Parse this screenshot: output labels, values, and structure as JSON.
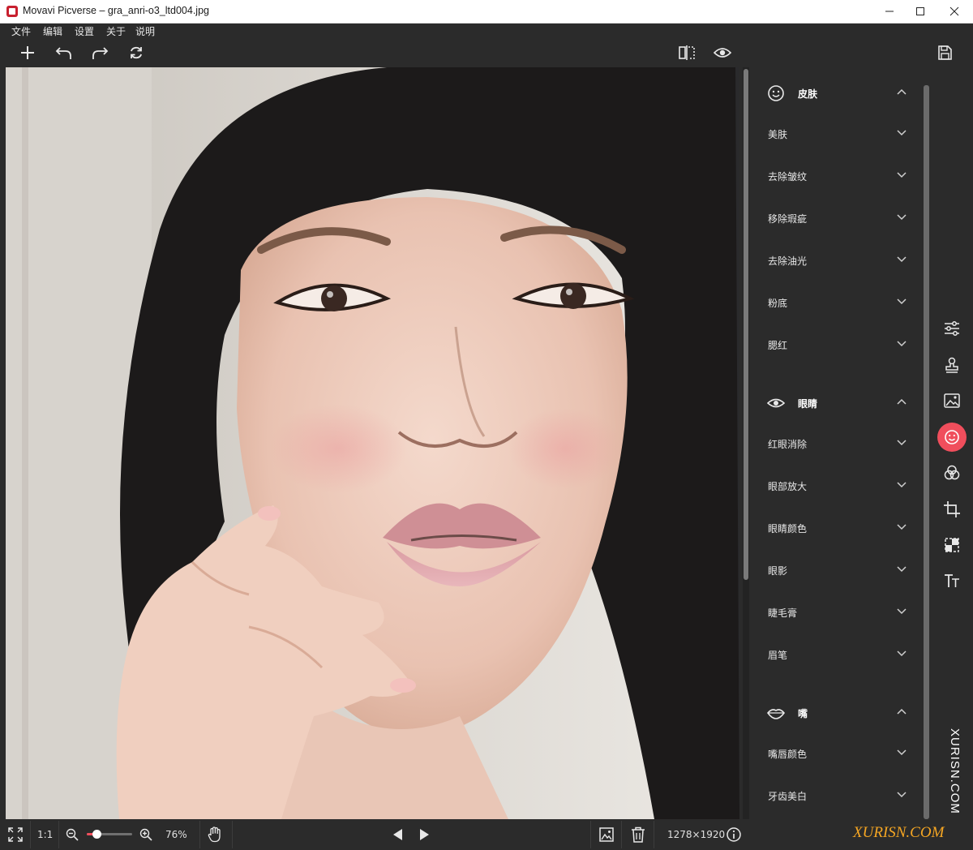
{
  "window": {
    "title": "Movavi Picverse – gra_anri-o3_ltd004.jpg"
  },
  "menu": {
    "items": [
      "文件",
      "编辑",
      "设置",
      "关于",
      "说明"
    ]
  },
  "toolbar": {
    "left_icons": [
      "plus-icon",
      "undo-icon",
      "redo-icon",
      "reset-icon"
    ],
    "center_icons": [
      "compare-icon",
      "preview-eye-icon"
    ],
    "right_icons": [
      "save-icon"
    ]
  },
  "panel": {
    "sections": [
      {
        "label": "皮肤",
        "icon": "smile-icon",
        "items": [
          "美肤",
          "去除皱纹",
          "移除瑕疵",
          "去除油光",
          "粉底",
          "腮红"
        ]
      },
      {
        "label": "眼睛",
        "icon": "eye-icon",
        "items": [
          "红眼消除",
          "眼部放大",
          "眼睛颜色",
          "眼影",
          "睫毛膏",
          "眉笔"
        ]
      },
      {
        "label": "嘴",
        "icon": "lips-icon",
        "items": [
          "嘴唇颜色",
          "牙齿美白"
        ]
      }
    ]
  },
  "right_tools": {
    "icons": [
      "adjust-sliders-icon",
      "stamp-icon",
      "image-enhance-icon",
      "retouch-face-icon",
      "filters-circles-icon",
      "crop-icon",
      "transform-icon",
      "text-icon"
    ],
    "active": "retouch-face-icon",
    "accent_color": "#f04e5c"
  },
  "status": {
    "fit_label": "1:1",
    "zoom_percent": "76%",
    "zoom_level": 0.16,
    "dimensions": "1278×1920"
  },
  "watermark": {
    "vertical": "XURISN.COM",
    "horizontal": "XURISN.COM"
  }
}
